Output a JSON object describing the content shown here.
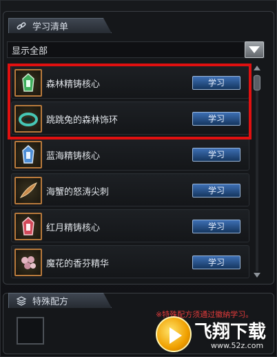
{
  "learn_list": {
    "title": "学习清单",
    "filter_label": "显示全部",
    "items": [
      {
        "name": "森林精铸核心",
        "button": "学习",
        "icon": "green-crystal-icon"
      },
      {
        "name": "跳跳兔的森林饰环",
        "button": "学习",
        "icon": "teal-ring-icon"
      },
      {
        "name": "蓝海精铸核心",
        "button": "学习",
        "icon": "blue-crystal-icon"
      },
      {
        "name": "海蟹的怒涛尖刺",
        "button": "学习",
        "icon": "crab-spike-icon"
      },
      {
        "name": "红月精铸核心",
        "button": "学习",
        "icon": "red-crystal-icon"
      },
      {
        "name": "魔花的香芬精华",
        "button": "学习",
        "icon": "flower-essence-icon"
      }
    ]
  },
  "special_recipes": {
    "title": "特殊配方",
    "notice": "※特殊配方须通过徽納学习。"
  },
  "watermark": {
    "title": "飞翔下载",
    "url": "www.52z.com"
  },
  "colors": {
    "highlight_border": "#e01010",
    "learn_button": "#2a5a9a",
    "notice_text": "#e33b3b"
  }
}
